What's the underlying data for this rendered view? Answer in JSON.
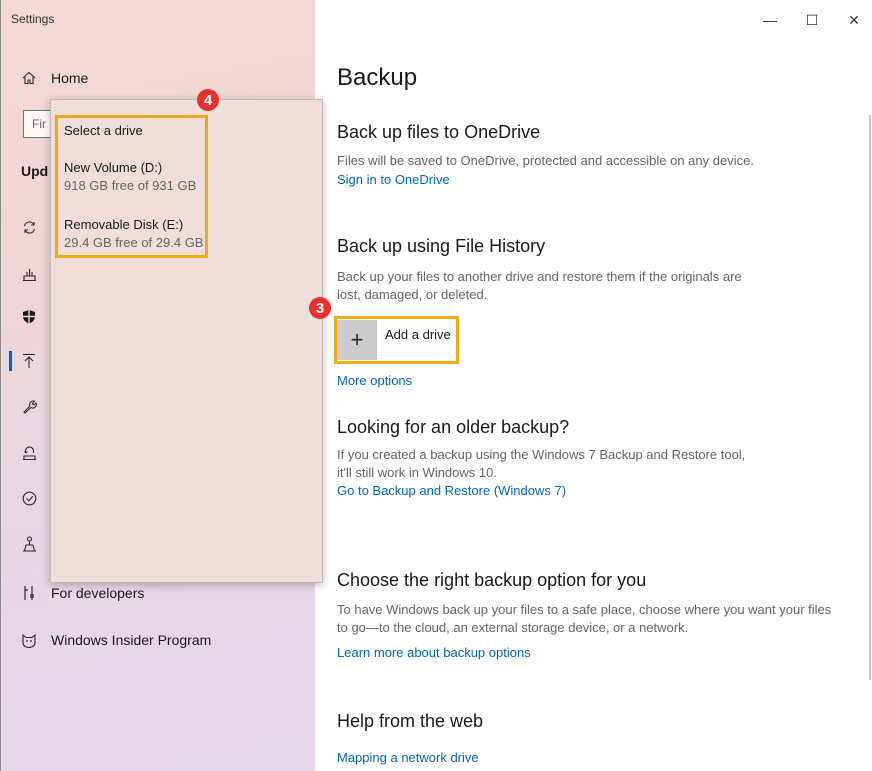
{
  "window": {
    "title": "Settings",
    "controls": {
      "minimize": "—",
      "maximize": "☐",
      "close": "✕"
    }
  },
  "sidebar": {
    "home_label": "Home",
    "search_fragment": "Fir",
    "section_fragment": "Upd",
    "items": [
      {
        "name": "windows-update",
        "label": ""
      },
      {
        "name": "delivery-optimization",
        "label": ""
      },
      {
        "name": "windows-security",
        "label": ""
      },
      {
        "name": "backup",
        "label": ""
      },
      {
        "name": "troubleshoot",
        "label": ""
      },
      {
        "name": "recovery",
        "label": ""
      },
      {
        "name": "activation",
        "label": ""
      },
      {
        "name": "find-my-device",
        "label": ""
      },
      {
        "name": "for-developers",
        "label": "For developers"
      },
      {
        "name": "windows-insider-program",
        "label": "Windows Insider Program"
      }
    ]
  },
  "dropdown": {
    "header": "Select a drive",
    "drives": [
      {
        "name": "New Volume (D:)",
        "free": "918 GB free of 931 GB"
      },
      {
        "name": "Removable Disk (E:)",
        "free": "29.4 GB free of 29.4 GB"
      }
    ],
    "badge": "4"
  },
  "main": {
    "title": "Backup",
    "onedrive": {
      "heading": "Back up files to OneDrive",
      "desc": "Files will be saved to OneDrive, protected and accessible on any device.",
      "link": "Sign in to OneDrive"
    },
    "file_history": {
      "heading": "Back up using File History",
      "desc_line1": "Back up your files to another drive and restore them if the originals are",
      "desc_line2": "lost, damaged, or deleted.",
      "add_drive_label": "Add a drive",
      "add_drive_icon": "+",
      "badge": "3",
      "more_options": "More options"
    },
    "older_backup": {
      "heading": "Looking for an older backup?",
      "desc_line1": "If you created a backup using the Windows 7 Backup and Restore tool,",
      "desc_line2": "it'll still work in Windows 10.",
      "link": "Go to Backup and Restore (Windows 7)"
    },
    "right_option": {
      "heading": "Choose the right backup option for you",
      "desc_line1": "To have Windows back up your files to a safe place, choose where you want your files",
      "desc_line2": "to go—to the cloud, an external storage device, or a network.",
      "link": "Learn more about backup options"
    },
    "help": {
      "heading": "Help from the web",
      "link": "Mapping a network drive"
    }
  },
  "colors": {
    "accent": "#0067c0",
    "highlight": "#f0aa17",
    "badge": "#e8302f"
  }
}
